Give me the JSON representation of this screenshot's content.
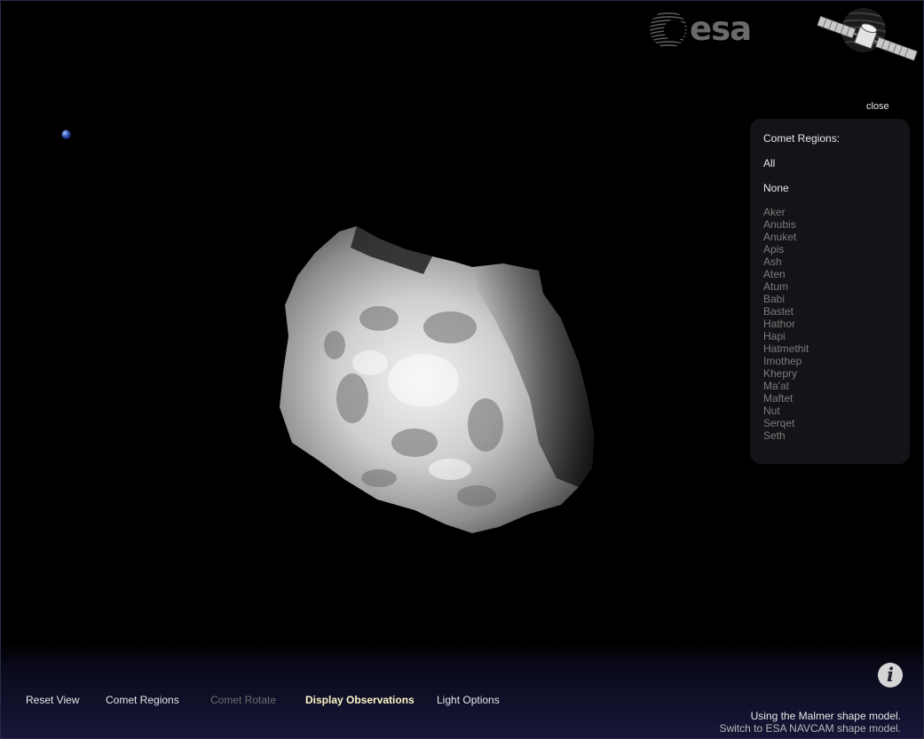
{
  "logo": {
    "text": "esa"
  },
  "panel": {
    "close_label": "close",
    "title": "Comet Regions:",
    "all_label": "All",
    "none_label": "None",
    "regions": [
      "Aker",
      "Anubis",
      "Anuket",
      "Apis",
      "Ash",
      "Aten",
      "Atum",
      "Babi",
      "Bastet",
      "Hathor",
      "Hapi",
      "Hatmethit",
      "Imothep",
      "Khepry",
      "Ma'at",
      "Maftet",
      "Nut",
      "Serqet",
      "Seth"
    ]
  },
  "nav": {
    "reset_view": "Reset View",
    "comet_regions": "Comet Regions",
    "comet_rotate": "Comet Rotate",
    "display_observations": "Display Observations",
    "light_options": "Light Options"
  },
  "info_icon": "info-icon",
  "info_glyph": "i",
  "status": {
    "shape_model": "Using the Malmer shape model.",
    "switch_link": "Switch to ESA NAVCAM shape model."
  },
  "colors": {
    "background": "#000000",
    "panel_bg": "#141418",
    "highlight": "#fff7c8",
    "disabled": "#6e6e6e",
    "region_text": "#7b7b7b"
  }
}
